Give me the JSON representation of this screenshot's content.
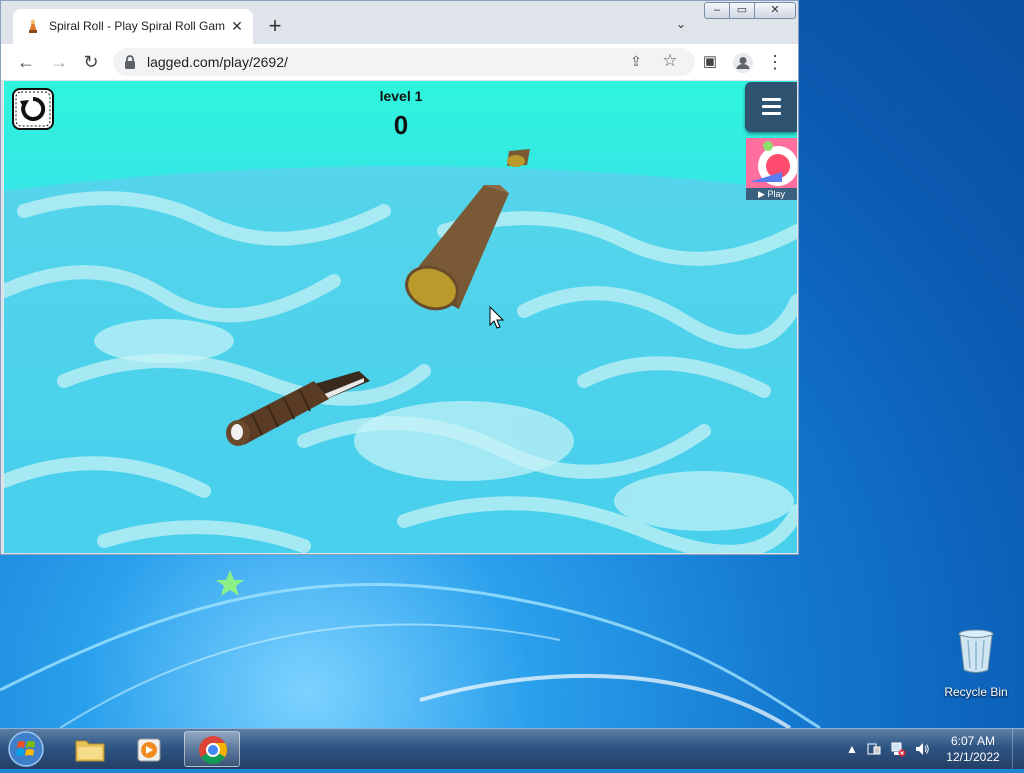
{
  "browser": {
    "tab_title": "Spiral Roll - Play Spiral Roll Game",
    "tab_close": "✕",
    "new_tab": "+",
    "tab_menu": "⌄",
    "url": "lagged.com/play/2692/",
    "window_min": "–",
    "window_max": "▭",
    "window_close": "✕"
  },
  "toolbar_icons": {
    "back": "←",
    "forward": "→",
    "reload": "↻",
    "share": "⇪",
    "star": "☆",
    "sidepanel": "▣",
    "menu": "⋮"
  },
  "game": {
    "level_label": "level 1",
    "score": "0",
    "promo_label": "▶ Play",
    "colors": {
      "sky": "#2ef5dc",
      "water": "#3fd8ea",
      "log": "#7a5a36",
      "log_end": "#b99a2a"
    }
  },
  "desktop": {
    "recycle_bin_label": "Recycle Bin"
  },
  "taskbar": {
    "time": "6:07 AM",
    "date": "12/1/2022"
  }
}
